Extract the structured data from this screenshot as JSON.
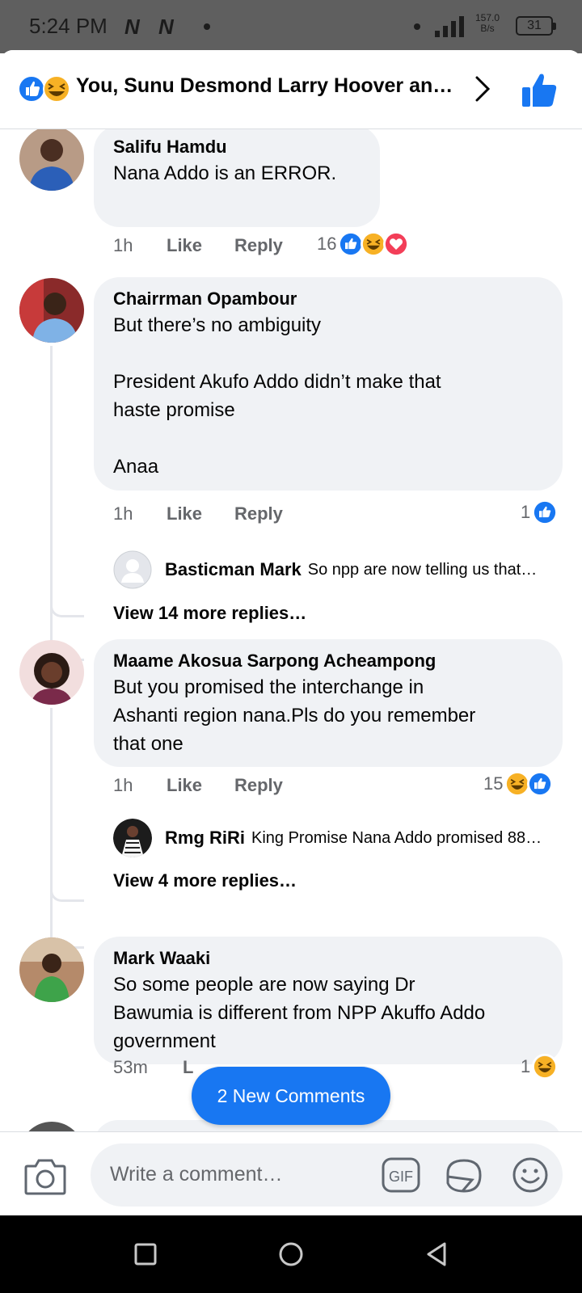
{
  "status_bar": {
    "time": "5:24 PM",
    "app_logo_1": "N",
    "app_logo_2": "N",
    "net_speed_value": "157.0",
    "net_speed_unit": "B/s",
    "battery": "31"
  },
  "header": {
    "title": "You, Sunu Desmond Larry Hoover an…"
  },
  "comments": [
    {
      "author": "Salifu Hamdu",
      "text": "Nana Addo is an ERROR.",
      "time": "1h",
      "like_label": "Like",
      "reply_label": "Reply",
      "reaction_count": "16",
      "reactions": [
        "like",
        "haha",
        "love"
      ]
    },
    {
      "author": "Chairrman Opambour",
      "text": "But there’s no ambiguity\n\nPresident Akufo Addo didn’t make that\nhaste promise\n\nAnaa",
      "time": "1h",
      "like_label": "Like",
      "reply_label": "Reply",
      "reaction_count": "1",
      "reactions": [
        "like"
      ],
      "reply_preview": {
        "author": "Basticman Mark",
        "text": "So npp are now telling us that…"
      },
      "view_more": "View 14 more replies…"
    },
    {
      "author": "Maame Akosua Sarpong Acheampong",
      "text": "But you promised the interchange in\nAshanti region nana.Pls do you remember\nthat one",
      "time": "1h",
      "like_label": "Like",
      "reply_label": "Reply",
      "reaction_count": "15",
      "reactions": [
        "haha",
        "like"
      ],
      "reply_preview": {
        "author": "Rmg RiRi",
        "text": "King Promise Nana Addo promised 88…"
      },
      "view_more": "View 4 more replies…"
    },
    {
      "author": "Mark Waaki",
      "text": "So some people are now saying Dr\nBawumia is different from NPP Akuffo Addo\ngovernment",
      "time": "53m",
      "like_label": "L",
      "reaction_count": "1",
      "reactions": [
        "haha"
      ]
    }
  ],
  "new_comments_pill": "2 New Comments",
  "composer": {
    "placeholder": "Write a comment…",
    "gif_label": "GIF"
  },
  "colors": {
    "accent": "#1877f2",
    "bubble": "#f0f2f5",
    "secondary_text": "#65676b",
    "love": "#f33e58",
    "haha": "#f7b125"
  }
}
